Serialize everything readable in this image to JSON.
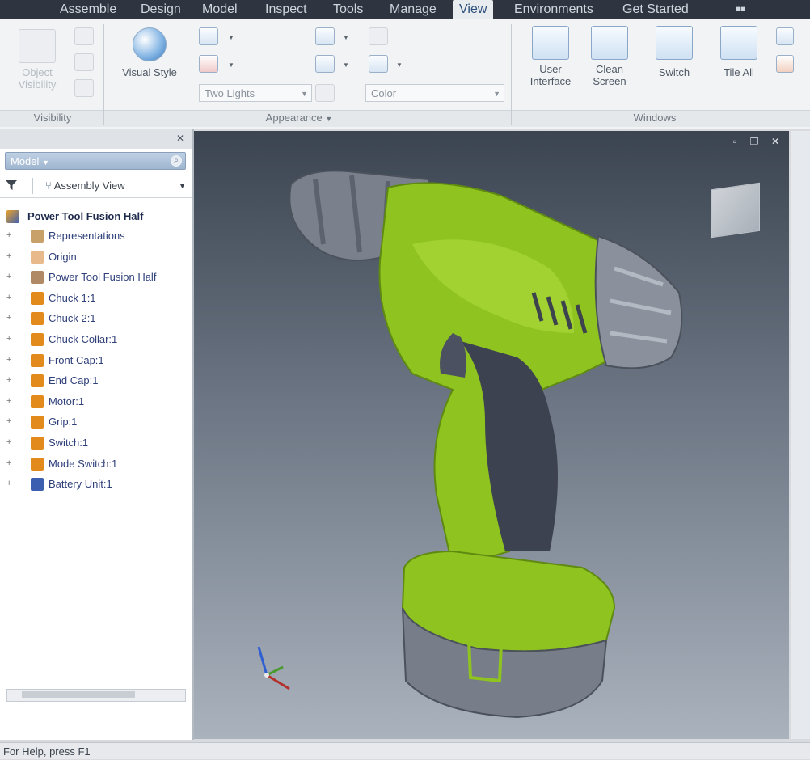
{
  "app": {
    "ribbon_tabs": [
      "Assemble",
      "Design",
      "Model",
      "Inspect",
      "Tools",
      "Manage",
      "View",
      "Environments",
      "Get Started"
    ],
    "active_tab": "View"
  },
  "ribbon": {
    "visibility": {
      "title": "Visibility",
      "object_visibility_label": "Object Visibility"
    },
    "appearance": {
      "title": "Appearance",
      "visual_style_label": "Visual Style",
      "lighting_value": "Two Lights",
      "color_value": "Color"
    },
    "windows": {
      "title": "Windows",
      "user_interface_label": "User Interface",
      "clean_screen_label": "Clean Screen",
      "switch_label": "Switch",
      "tile_all_label": "Tile All"
    }
  },
  "browser": {
    "dropdown_label": "Model",
    "view_label": "Assembly View",
    "root": "Power Tool Fusion Half",
    "items": [
      {
        "label": "Representations",
        "icon": "representations-icon",
        "color": "#c8a06a"
      },
      {
        "label": "Origin",
        "icon": "origin-folder-icon",
        "color": "#e8b98a"
      },
      {
        "label": "Power Tool Fusion Half",
        "icon": "part-icon",
        "color": "#b08a66"
      },
      {
        "label": "Chuck 1:1",
        "icon": "part-icon",
        "color": "#e38a1c"
      },
      {
        "label": "Chuck 2:1",
        "icon": "part-icon",
        "color": "#e38a1c"
      },
      {
        "label": "Chuck Collar:1",
        "icon": "part-icon",
        "color": "#e38a1c"
      },
      {
        "label": "Front Cap:1",
        "icon": "part-icon",
        "color": "#e38a1c"
      },
      {
        "label": "End Cap:1",
        "icon": "part-icon",
        "color": "#e38a1c"
      },
      {
        "label": "Motor:1",
        "icon": "part-icon",
        "color": "#e38a1c"
      },
      {
        "label": "Grip:1",
        "icon": "part-icon",
        "color": "#e38a1c"
      },
      {
        "label": "Switch:1",
        "icon": "part-icon",
        "color": "#e38a1c"
      },
      {
        "label": "Mode Switch:1",
        "icon": "part-icon",
        "color": "#e38a1c"
      },
      {
        "label": "Battery Unit:1",
        "icon": "subassembly-icon",
        "color": "#3d5fb0"
      }
    ]
  },
  "status": {
    "text": "For Help, press F1"
  },
  "colors": {
    "tab_bar": "#2e3540",
    "drill_green": "#8fc31f",
    "drill_grey": "#7a818c",
    "viewport_top": "#3b4450",
    "viewport_bottom": "#aab2bd"
  }
}
